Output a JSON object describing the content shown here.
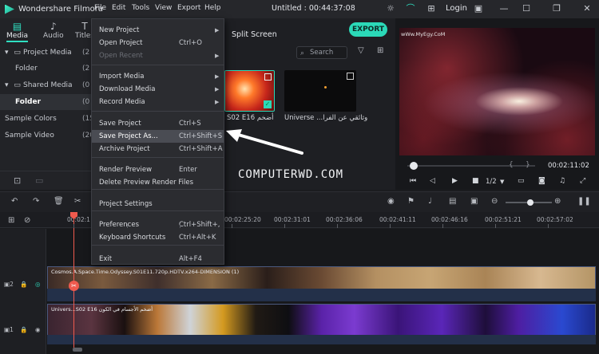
{
  "app": {
    "name": "Wondershare Filmora",
    "doc_title": "Untitled : 00:44:37:08",
    "login": "Login"
  },
  "menubar": [
    "File",
    "Edit",
    "Tools",
    "View",
    "Export",
    "Help"
  ],
  "media_tabs": [
    {
      "label": "Media",
      "icon": "media-icon"
    },
    {
      "label": "Audio",
      "icon": "music-note-icon"
    },
    {
      "label": "Titles",
      "icon": "text-t-icon"
    }
  ],
  "tree": [
    {
      "label": "Project Media",
      "count": "(2"
    },
    {
      "label": "Folder",
      "count": "(2"
    },
    {
      "label": "Shared Media",
      "count": "(0"
    },
    {
      "label": "Folder",
      "count": "(0"
    },
    {
      "label": "Sample Colors",
      "count": "(15"
    },
    {
      "label": "Sample Video",
      "count": "(20"
    }
  ],
  "library": {
    "split_screen": "Split Screen",
    "export": "EXPORT",
    "search_placeholder": "Search",
    "thumbs": [
      {
        "label": "S02 E16 أضخم"
      },
      {
        "label": "Universe ...وثائقي عن الفرا"
      }
    ]
  },
  "file_menu": {
    "items": [
      {
        "label": "New Project",
        "shortcut": "",
        "submenu": true,
        "disabled": false
      },
      {
        "label": "Open Project",
        "shortcut": "Ctrl+O",
        "submenu": false,
        "disabled": false
      },
      {
        "label": "Open Recent",
        "shortcut": "",
        "submenu": true,
        "disabled": true
      },
      {
        "label": "Import Media",
        "shortcut": "",
        "submenu": true,
        "disabled": false
      },
      {
        "label": "Download Media",
        "shortcut": "",
        "submenu": true,
        "disabled": false
      },
      {
        "label": "Record Media",
        "shortcut": "",
        "submenu": true,
        "disabled": false
      },
      {
        "label": "Save Project",
        "shortcut": "Ctrl+S",
        "submenu": false,
        "disabled": false
      },
      {
        "label": "Save Project As...",
        "shortcut": "Ctrl+Shift+S",
        "submenu": false,
        "disabled": false,
        "highlighted": true
      },
      {
        "label": "Archive Project",
        "shortcut": "Ctrl+Shift+A",
        "submenu": false,
        "disabled": false
      },
      {
        "label": "Render Preview",
        "shortcut": "Enter",
        "submenu": false,
        "disabled": false
      },
      {
        "label": "Delete Preview Render Files",
        "shortcut": "",
        "submenu": false,
        "disabled": false
      },
      {
        "label": "Project Settings",
        "shortcut": "",
        "submenu": false,
        "disabled": false
      },
      {
        "label": "Preferences",
        "shortcut": "Ctrl+Shift+,",
        "submenu": false,
        "disabled": false
      },
      {
        "label": "Keyboard Shortcuts",
        "shortcut": "Ctrl+Alt+K",
        "submenu": false,
        "disabled": false
      },
      {
        "label": "Exit",
        "shortcut": "Alt+F4",
        "submenu": false,
        "disabled": false
      }
    ]
  },
  "preview": {
    "watermark_small": "wWw.MyEgy.CoM",
    "timecode": "00:02:11:02",
    "ratio": "1/2",
    "playback_progress": 0.02
  },
  "center_watermark": "COMPUTERWD.COM",
  "ruler_labels": [
    "00:02:1",
    "00:02:25:20",
    "00:02:31:01",
    "00:02:36:06",
    "00:02:41:11",
    "00:02:46:16",
    "00:02:51:21",
    "00:02:57:02"
  ],
  "tracks": {
    "video2": {
      "head": "2",
      "clip_name": "Cosmos.A.Space.Time.Odyssey.S01E11.720p.HDTV.x264-DIMENSION (1)"
    },
    "video1": {
      "head": "1",
      "clip_name": "Univers...S02 E16 أضخم الأجسام في الكون"
    }
  },
  "colors": {
    "accent": "#2bd9b8",
    "playhead": "#ef5a4e",
    "menu_bg": "#2b2c30"
  }
}
